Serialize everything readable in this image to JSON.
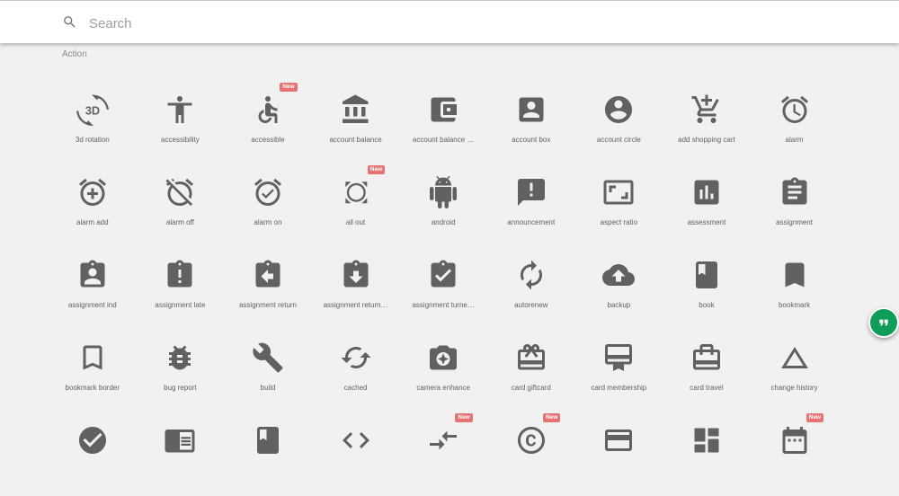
{
  "search": {
    "placeholder": "Search",
    "icon": "search-icon"
  },
  "section": {
    "title": "Action"
  },
  "colors": {
    "icon": "#616161",
    "badge": "#e57373",
    "fab": "#0f9d58"
  },
  "fab": {
    "icon": "quote-icon"
  },
  "icons": [
    {
      "label": "3d rotation",
      "icon": "3d-rotation-icon",
      "badge": ""
    },
    {
      "label": "accessibility",
      "icon": "accessibility-icon",
      "badge": ""
    },
    {
      "label": "accessible",
      "icon": "accessible-icon",
      "badge": "New"
    },
    {
      "label": "account balance",
      "icon": "account-balance-icon",
      "badge": ""
    },
    {
      "label": "account balance …",
      "icon": "account-balance-wallet-icon",
      "badge": ""
    },
    {
      "label": "account box",
      "icon": "account-box-icon",
      "badge": ""
    },
    {
      "label": "account circle",
      "icon": "account-circle-icon",
      "badge": ""
    },
    {
      "label": "add shopping cart",
      "icon": "add-shopping-cart-icon",
      "badge": ""
    },
    {
      "label": "alarm",
      "icon": "alarm-icon",
      "badge": ""
    },
    {
      "label": "alarm add",
      "icon": "alarm-add-icon",
      "badge": ""
    },
    {
      "label": "alarm off",
      "icon": "alarm-off-icon",
      "badge": ""
    },
    {
      "label": "alarm on",
      "icon": "alarm-on-icon",
      "badge": ""
    },
    {
      "label": "all out",
      "icon": "all-out-icon",
      "badge": "New"
    },
    {
      "label": "android",
      "icon": "android-icon",
      "badge": ""
    },
    {
      "label": "announcement",
      "icon": "announcement-icon",
      "badge": ""
    },
    {
      "label": "aspect ratio",
      "icon": "aspect-ratio-icon",
      "badge": ""
    },
    {
      "label": "assessment",
      "icon": "assessment-icon",
      "badge": ""
    },
    {
      "label": "assignment",
      "icon": "assignment-icon",
      "badge": ""
    },
    {
      "label": "assignment ind",
      "icon": "assignment-ind-icon",
      "badge": ""
    },
    {
      "label": "assignment late",
      "icon": "assignment-late-icon",
      "badge": ""
    },
    {
      "label": "assignment return",
      "icon": "assignment-return-icon",
      "badge": ""
    },
    {
      "label": "assignment return…",
      "icon": "assignment-returned-icon",
      "badge": ""
    },
    {
      "label": "assignment turne…",
      "icon": "assignment-turned-in-icon",
      "badge": ""
    },
    {
      "label": "autorenew",
      "icon": "autorenew-icon",
      "badge": ""
    },
    {
      "label": "backup",
      "icon": "backup-icon",
      "badge": ""
    },
    {
      "label": "book",
      "icon": "book-icon",
      "badge": ""
    },
    {
      "label": "bookmark",
      "icon": "bookmark-icon",
      "badge": ""
    },
    {
      "label": "bookmark border",
      "icon": "bookmark-border-icon",
      "badge": ""
    },
    {
      "label": "bug report",
      "icon": "bug-report-icon",
      "badge": ""
    },
    {
      "label": "build",
      "icon": "build-icon",
      "badge": ""
    },
    {
      "label": "cached",
      "icon": "cached-icon",
      "badge": ""
    },
    {
      "label": "camera enhance",
      "icon": "camera-enhance-icon",
      "badge": ""
    },
    {
      "label": "card giftcard",
      "icon": "card-giftcard-icon",
      "badge": ""
    },
    {
      "label": "card membership",
      "icon": "card-membership-icon",
      "badge": ""
    },
    {
      "label": "card travel",
      "icon": "card-travel-icon",
      "badge": ""
    },
    {
      "label": "change history",
      "icon": "change-history-icon",
      "badge": ""
    },
    {
      "label": "",
      "icon": "check-circle-icon",
      "badge": ""
    },
    {
      "label": "",
      "icon": "chrome-reader-mode-icon",
      "badge": ""
    },
    {
      "label": "",
      "icon": "class-icon",
      "badge": ""
    },
    {
      "label": "",
      "icon": "code-icon",
      "badge": ""
    },
    {
      "label": "",
      "icon": "compare-arrows-icon",
      "badge": "New"
    },
    {
      "label": "",
      "icon": "copyright-icon",
      "badge": "New"
    },
    {
      "label": "",
      "icon": "credit-card-icon",
      "badge": ""
    },
    {
      "label": "",
      "icon": "dashboard-icon",
      "badge": ""
    },
    {
      "label": "",
      "icon": "date-range-icon",
      "badge": "New"
    }
  ]
}
